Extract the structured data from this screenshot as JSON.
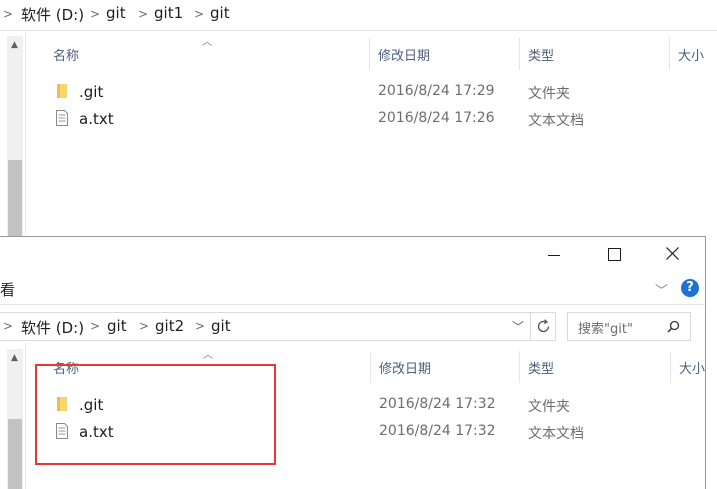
{
  "window1": {
    "breadcrumb": [
      "软件 (D:)",
      "git",
      "git1",
      "git"
    ],
    "columns": {
      "name": "名称",
      "modified": "修改日期",
      "type": "类型",
      "size": "大小"
    },
    "files": [
      {
        "name": ".git",
        "modified": "2016/8/24 17:29",
        "type": "文件夹",
        "icon": "folder-icon"
      },
      {
        "name": "a.txt",
        "modified": "2016/8/24 17:26",
        "type": "文本文档",
        "icon": "text-file-icon"
      }
    ]
  },
  "window2": {
    "ribbon_partial_label": "看",
    "breadcrumb": [
      "软件 (D:)",
      "git",
      "git2",
      "git"
    ],
    "search_placeholder": "搜索\"git\"",
    "columns": {
      "name": "名称",
      "modified": "修改日期",
      "type": "类型",
      "size": "大小"
    },
    "files": [
      {
        "name": ".git",
        "modified": "2016/8/24 17:32",
        "type": "文件夹",
        "icon": "folder-icon"
      },
      {
        "name": "a.txt",
        "modified": "2016/8/24 17:32",
        "type": "文本文档",
        "icon": "text-file-icon"
      }
    ],
    "highlight_color": "#e53935"
  },
  "colors": {
    "accent": "#0067c0",
    "help_blue": "#1c73d2"
  }
}
